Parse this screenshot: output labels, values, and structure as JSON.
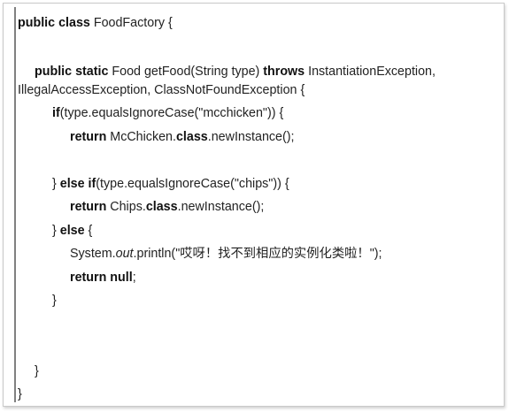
{
  "code": {
    "l1": {
      "kw": "public class",
      "t": " FoodFactory {"
    },
    "l2": {
      "kw": "public static",
      "t1": " Food getFood(String type) ",
      "kw2": "throws",
      "t2": " InstantiationException,"
    },
    "l3": {
      "t": "IllegalAccessException, ClassNotFoundException {"
    },
    "l4": {
      "kw": "if",
      "t": "(type.equalsIgnoreCase(\"mcchicken\")) {"
    },
    "l5": {
      "kw": "return",
      "t1": " McChicken.",
      "kw2": "class",
      "t2": ".newInstance();"
    },
    "l6": {
      "t1": "} ",
      "kw": "else if",
      "t2": "(type.equalsIgnoreCase(\"chips\")) {"
    },
    "l7": {
      "kw": "return",
      "t1": " Chips.",
      "kw2": "class",
      "t2": ".newInstance();"
    },
    "l8": {
      "t1": "} ",
      "kw": "else",
      "t2": " {"
    },
    "l9": {
      "t1": "System.",
      "it": "out",
      "t2": ".println(\"哎呀！找不到相应的实例化类啦！\");"
    },
    "l10": {
      "kw": "return null",
      "t": ";"
    },
    "l11": {
      "t": "}"
    },
    "l12": {
      "t": "}"
    },
    "l13": {
      "t": "}"
    }
  }
}
